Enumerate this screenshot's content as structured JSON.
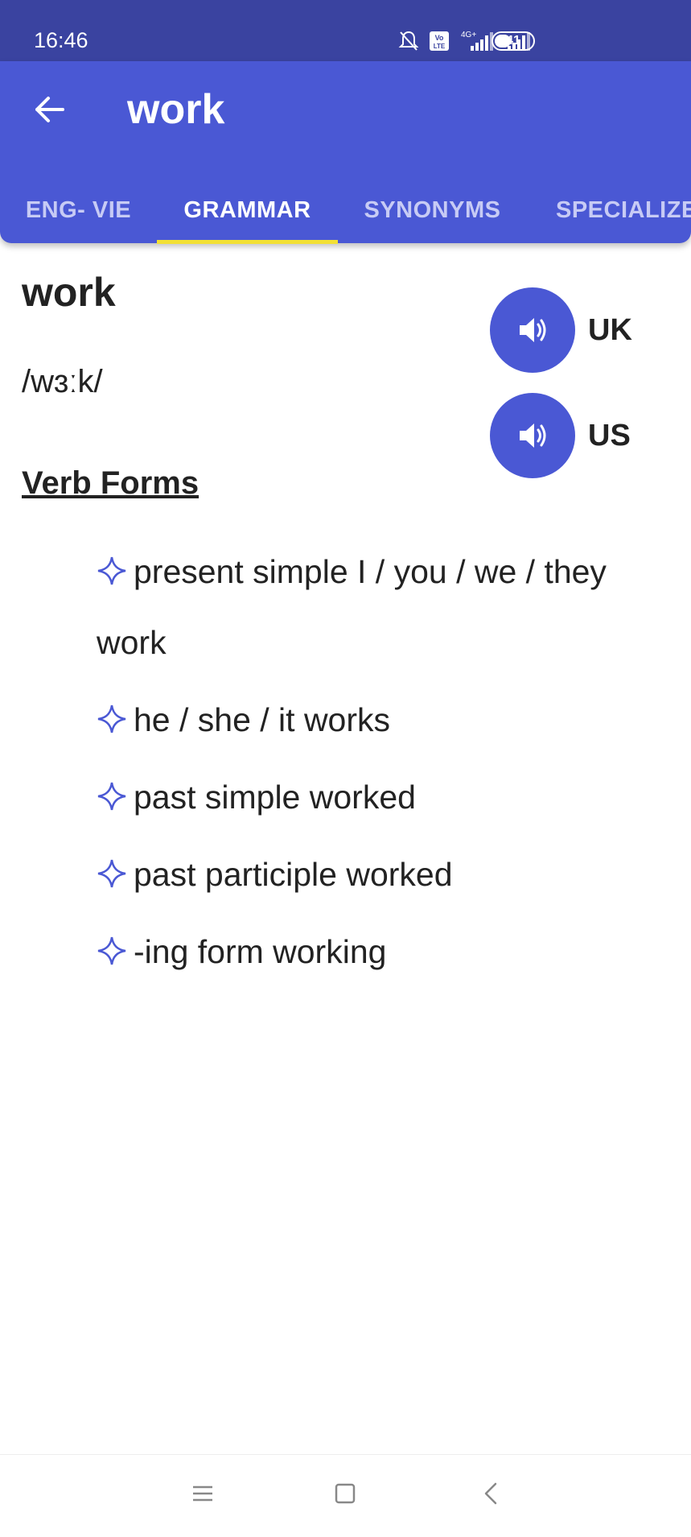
{
  "status_bar": {
    "time": "16:46",
    "battery": "41",
    "network": "4G+"
  },
  "app_bar": {
    "title": "work",
    "back_icon": "arrow-left-icon"
  },
  "tabs": [
    {
      "label": "ENG- VIE",
      "active": false
    },
    {
      "label": "GRAMMAR",
      "active": true
    },
    {
      "label": "SYNONYMS",
      "active": false
    },
    {
      "label": "SPECIALIZE",
      "active": false
    }
  ],
  "entry": {
    "word": "work",
    "phonetic": "/wɜːk/",
    "audio": [
      {
        "label": "UK",
        "icon": "speaker-icon"
      },
      {
        "label": "US",
        "icon": "speaker-icon"
      }
    ]
  },
  "verb_forms": {
    "title": "Verb Forms",
    "items": [
      "present simple I / you / we / they work",
      "he / she / it works",
      "past simple worked",
      "past participle worked",
      "-ing form working"
    ]
  },
  "colors": {
    "status_bar": "#3a43a0",
    "app_bar": "#4a58d4",
    "tab_indicator": "#f2e035",
    "star": "#4a58d4"
  },
  "nav_bar": {
    "icons": [
      "menu-icon",
      "home-square-icon",
      "back-chevron-icon"
    ]
  }
}
